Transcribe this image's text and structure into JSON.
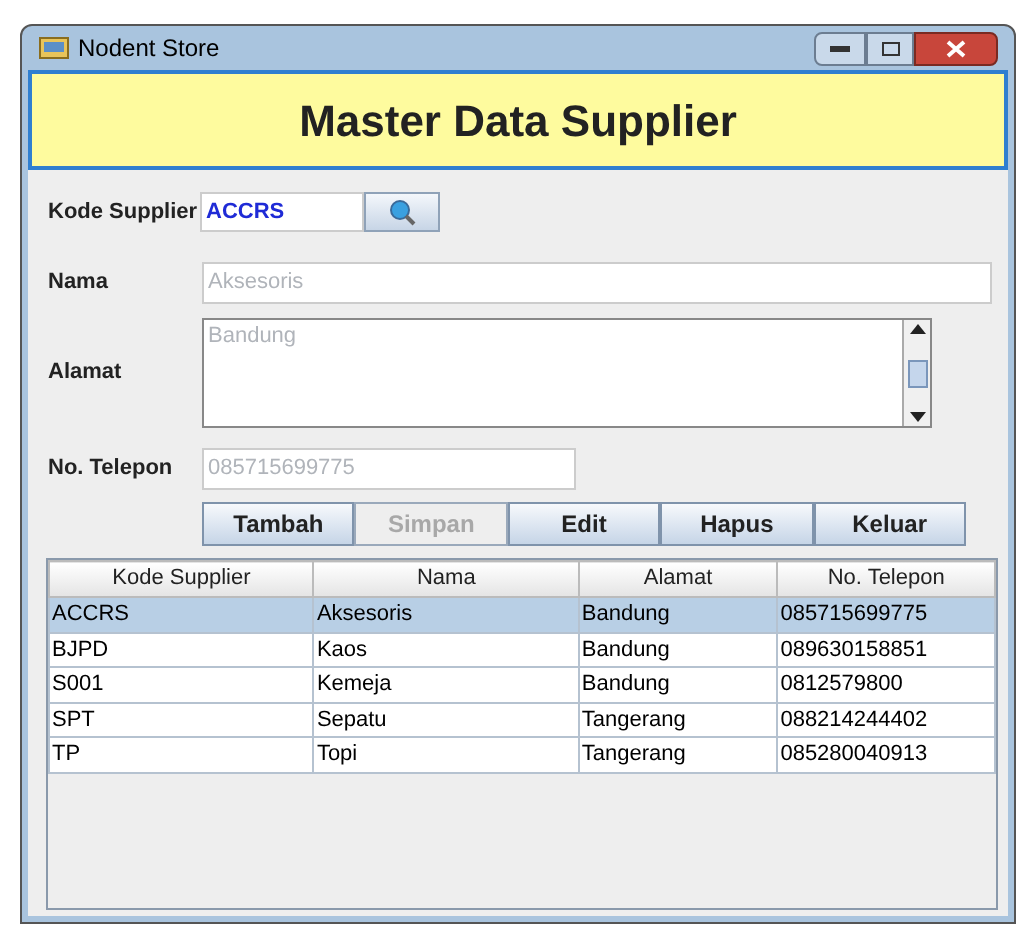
{
  "window": {
    "title": "Nodent Store"
  },
  "header": {
    "title": "Master Data Supplier"
  },
  "form": {
    "kode": {
      "label": "Kode Supplier",
      "value": "ACCRS",
      "disabled": false
    },
    "nama": {
      "label": "Nama",
      "value": "Aksesoris",
      "disabled": true
    },
    "alamat": {
      "label": "Alamat",
      "value": "Bandung",
      "disabled": true
    },
    "telepon": {
      "label": "No. Telepon",
      "value": "085715699775",
      "disabled": true
    }
  },
  "buttons": [
    {
      "label": "Tambah",
      "disabled": false
    },
    {
      "label": "Simpan",
      "disabled": true
    },
    {
      "label": "Edit",
      "disabled": false
    },
    {
      "label": "Hapus",
      "disabled": false
    },
    {
      "label": "Keluar",
      "disabled": false
    }
  ],
  "table": {
    "columns": [
      "Kode Supplier",
      "Nama",
      "Alamat",
      "No. Telepon"
    ],
    "rows": [
      {
        "cells": [
          "ACCRS",
          "Aksesoris",
          "Bandung",
          "085715699775"
        ],
        "selected": true
      },
      {
        "cells": [
          "BJPD",
          "Kaos",
          "Bandung",
          "089630158851"
        ],
        "selected": false
      },
      {
        "cells": [
          "S001",
          "Kemeja",
          "Bandung",
          "0812579800"
        ],
        "selected": false
      },
      {
        "cells": [
          "SPT",
          "Sepatu",
          "Tangerang",
          "088214244402"
        ],
        "selected": false
      },
      {
        "cells": [
          "TP",
          "Topi",
          "Tangerang",
          "085280040913"
        ],
        "selected": false
      }
    ]
  }
}
